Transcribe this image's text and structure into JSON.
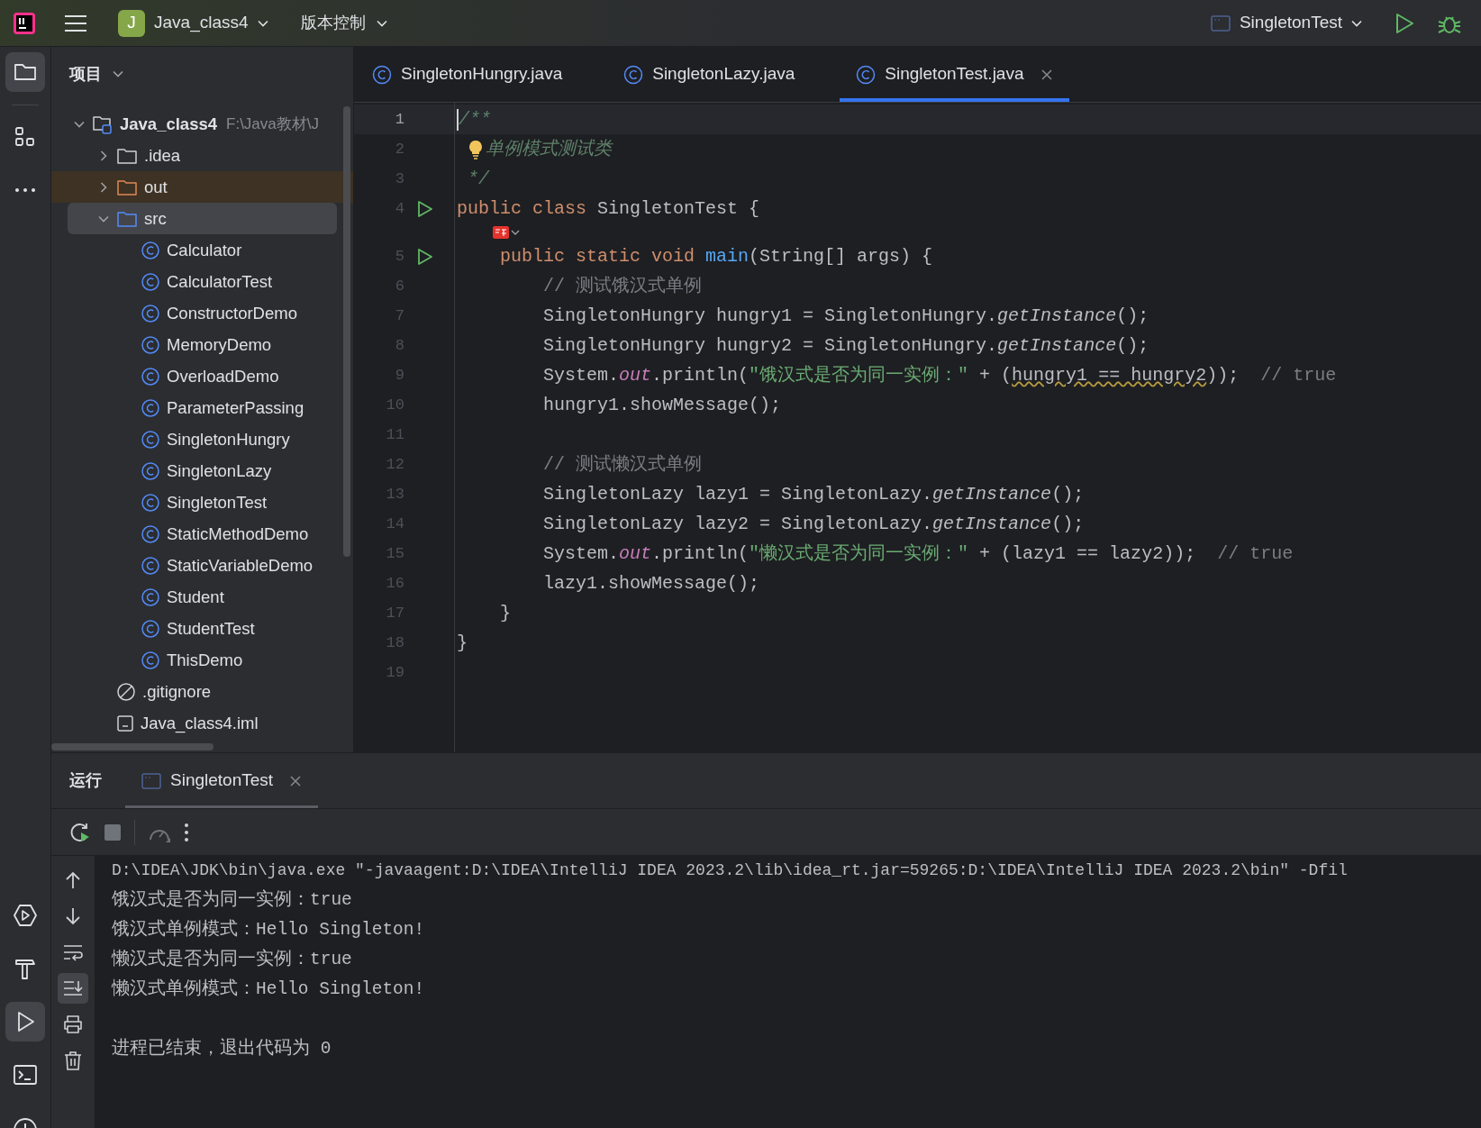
{
  "title_bar": {
    "project_badge": "J",
    "project_name": "Java_class4",
    "vcs_menu": "版本控制",
    "run_config": "SingletonTest"
  },
  "left_toolbar": {
    "top": [
      {
        "kind": "project",
        "selected": true
      },
      {
        "kind": "structure",
        "selected": false
      },
      {
        "kind": "more",
        "selected": false
      }
    ],
    "bottom": [
      {
        "kind": "services",
        "selected": false
      },
      {
        "kind": "build",
        "selected": false
      },
      {
        "kind": "run",
        "selected": true
      },
      {
        "kind": "terminal",
        "selected": false
      },
      {
        "kind": "problems",
        "selected": false
      }
    ]
  },
  "project_panel": {
    "title": "项目",
    "tree": [
      {
        "kind": "module",
        "label": "Java_class4",
        "path": "F:\\Java教材\\J",
        "expanded": true,
        "selected": false,
        "children": [
          {
            "kind": "folder",
            "label": ".idea",
            "expanded": false,
            "selected": false
          },
          {
            "kind": "excluded_folder",
            "label": "out",
            "expanded": false,
            "selected": false
          },
          {
            "kind": "source_folder",
            "label": "src",
            "expanded": true,
            "selected": true,
            "children": [
              {
                "kind": "class",
                "label": "Calculator",
                "selected": false
              },
              {
                "kind": "class",
                "label": "CalculatorTest",
                "selected": false
              },
              {
                "kind": "class",
                "label": "ConstructorDemo",
                "selected": false
              },
              {
                "kind": "class",
                "label": "MemoryDemo",
                "selected": false
              },
              {
                "kind": "class",
                "label": "OverloadDemo",
                "selected": false
              },
              {
                "kind": "class",
                "label": "ParameterPassing",
                "selected": false
              },
              {
                "kind": "class",
                "label": "SingletonHungry",
                "selected": false
              },
              {
                "kind": "class",
                "label": "SingletonLazy",
                "selected": false
              },
              {
                "kind": "class",
                "label": "SingletonTest",
                "selected": false
              },
              {
                "kind": "class",
                "label": "StaticMethodDemo",
                "selected": false
              },
              {
                "kind": "class",
                "label": "StaticVariableDemo",
                "selected": false
              },
              {
                "kind": "class",
                "label": "Student",
                "selected": false
              },
              {
                "kind": "class",
                "label": "StudentTest",
                "selected": false
              },
              {
                "kind": "class",
                "label": "ThisDemo",
                "selected": false
              }
            ]
          },
          {
            "kind": "ignore_file",
            "label": ".gitignore",
            "selected": false
          },
          {
            "kind": "module_file",
            "label": "Java_class4.iml",
            "selected": false
          }
        ]
      }
    ]
  },
  "editor_tabs": [
    {
      "label": "SingletonHungry.java",
      "selected": false
    },
    {
      "label": "SingletonLazy.java",
      "selected": false
    },
    {
      "label": "SingletonTest.java",
      "selected": true
    }
  ],
  "editor": {
    "lines": [
      {
        "kind": "code",
        "number": "1",
        "current": true,
        "run": false,
        "bulb": false,
        "tokens": [
          {
            "kind": "doc",
            "text": "/**"
          }
        ]
      },
      {
        "kind": "code",
        "number": "2",
        "current": false,
        "run": false,
        "bulb": true,
        "tokens": [
          {
            "kind": "doc",
            "text": "单例模式测试类"
          }
        ]
      },
      {
        "kind": "code",
        "number": "3",
        "current": false,
        "run": false,
        "bulb": false,
        "tokens": [
          {
            "kind": "doc",
            "text": " */"
          }
        ]
      },
      {
        "kind": "code",
        "number": "4",
        "current": false,
        "run": true,
        "bulb": false,
        "tokens": [
          {
            "kind": "keyword",
            "text": "public class "
          },
          {
            "kind": "plain",
            "text": "SingletonTest {"
          }
        ]
      },
      {
        "kind": "inlay"
      },
      {
        "kind": "code",
        "number": "5",
        "current": false,
        "run": true,
        "bulb": false,
        "tokens": [
          {
            "kind": "keyword",
            "text": "    public static void "
          },
          {
            "kind": "method",
            "text": "main"
          },
          {
            "kind": "plain",
            "text": "(String[] args) {"
          }
        ]
      },
      {
        "kind": "code",
        "number": "6",
        "current": false,
        "run": false,
        "bulb": false,
        "tokens": [
          {
            "kind": "comment",
            "text": "        // 测试饿汉式单例"
          }
        ]
      },
      {
        "kind": "code",
        "number": "7",
        "current": false,
        "run": false,
        "bulb": false,
        "tokens": [
          {
            "kind": "plain",
            "text": "        SingletonHungry hungry1 = SingletonHungry."
          },
          {
            "kind": "italic",
            "text": "getInstance"
          },
          {
            "kind": "plain",
            "text": "();"
          }
        ]
      },
      {
        "kind": "code",
        "number": "8",
        "current": false,
        "run": false,
        "bulb": false,
        "tokens": [
          {
            "kind": "plain",
            "text": "        SingletonHungry hungry2 = SingletonHungry."
          },
          {
            "kind": "italic",
            "text": "getInstance"
          },
          {
            "kind": "plain",
            "text": "();"
          }
        ]
      },
      {
        "kind": "code",
        "number": "9",
        "current": false,
        "run": false,
        "bulb": false,
        "tokens": [
          {
            "kind": "plain",
            "text": "        System."
          },
          {
            "kind": "static",
            "text": "out"
          },
          {
            "kind": "plain",
            "text": ".println("
          },
          {
            "kind": "string",
            "text": "\"饿汉式是否为同一实例：\""
          },
          {
            "kind": "plain",
            "text": " + ("
          },
          {
            "kind": "warning",
            "text": "hungry1 == hungry2"
          },
          {
            "kind": "plain",
            "text": "));  "
          },
          {
            "kind": "comment",
            "text": "// true"
          }
        ]
      },
      {
        "kind": "code",
        "number": "10",
        "current": false,
        "run": false,
        "bulb": false,
        "tokens": [
          {
            "kind": "plain",
            "text": "        hungry1.showMessage();"
          }
        ]
      },
      {
        "kind": "code",
        "number": "11",
        "current": false,
        "run": false,
        "bulb": false
      },
      {
        "kind": "code",
        "number": "12",
        "current": false,
        "run": false,
        "bulb": false,
        "tokens": [
          {
            "kind": "comment",
            "text": "        // 测试懒汉式单例"
          }
        ]
      },
      {
        "kind": "code",
        "number": "13",
        "current": false,
        "run": false,
        "bulb": false,
        "tokens": [
          {
            "kind": "plain",
            "text": "        SingletonLazy lazy1 = SingletonLazy."
          },
          {
            "kind": "italic",
            "text": "getInstance"
          },
          {
            "kind": "plain",
            "text": "();"
          }
        ]
      },
      {
        "kind": "code",
        "number": "14",
        "current": false,
        "run": false,
        "bulb": false,
        "tokens": [
          {
            "kind": "plain",
            "text": "        SingletonLazy lazy2 = SingletonLazy."
          },
          {
            "kind": "italic",
            "text": "getInstance"
          },
          {
            "kind": "plain",
            "text": "();"
          }
        ]
      },
      {
        "kind": "code",
        "number": "15",
        "current": false,
        "run": false,
        "bulb": false,
        "tokens": [
          {
            "kind": "plain",
            "text": "        System."
          },
          {
            "kind": "static",
            "text": "out"
          },
          {
            "kind": "plain",
            "text": ".println("
          },
          {
            "kind": "string",
            "text": "\"懒汉式是否为同一实例：\""
          },
          {
            "kind": "plain",
            "text": " + (lazy1 == lazy2));  "
          },
          {
            "kind": "comment",
            "text": "// true"
          }
        ]
      },
      {
        "kind": "code",
        "number": "16",
        "current": false,
        "run": false,
        "bulb": false,
        "tokens": [
          {
            "kind": "plain",
            "text": "        lazy1.showMessage();"
          }
        ]
      },
      {
        "kind": "code",
        "number": "17",
        "current": false,
        "run": false,
        "bulb": false,
        "tokens": [
          {
            "kind": "plain",
            "text": "    }"
          }
        ]
      },
      {
        "kind": "code",
        "number": "18",
        "current": false,
        "run": false,
        "bulb": false,
        "tokens": [
          {
            "kind": "plain",
            "text": "}"
          }
        ]
      },
      {
        "kind": "code",
        "number": "19",
        "current": false,
        "run": false,
        "bulb": false
      }
    ]
  },
  "run_panel": {
    "title": "运行",
    "tabs": [
      {
        "label": "SingletonTest",
        "selected": true
      }
    ],
    "console": [
      {
        "kind": "command",
        "text": "D:\\IDEA\\JDK\\bin\\java.exe \"-javaagent:D:\\IDEA\\IntelliJ IDEA 2023.2\\lib\\idea_rt.jar=59265:D:\\IDEA\\IntelliJ IDEA 2023.2\\bin\" -Dfil"
      },
      {
        "kind": "output",
        "text": "饿汉式是否为同一实例：true"
      },
      {
        "kind": "output",
        "text": "饿汉式单例模式：Hello Singleton!"
      },
      {
        "kind": "output",
        "text": "懒汉式是否为同一实例：true"
      },
      {
        "kind": "output",
        "text": "懒汉式单例模式：Hello Singleton!"
      },
      {
        "kind": "blank"
      },
      {
        "kind": "output",
        "text": "进程已结束，退出代码为 0"
      }
    ]
  }
}
